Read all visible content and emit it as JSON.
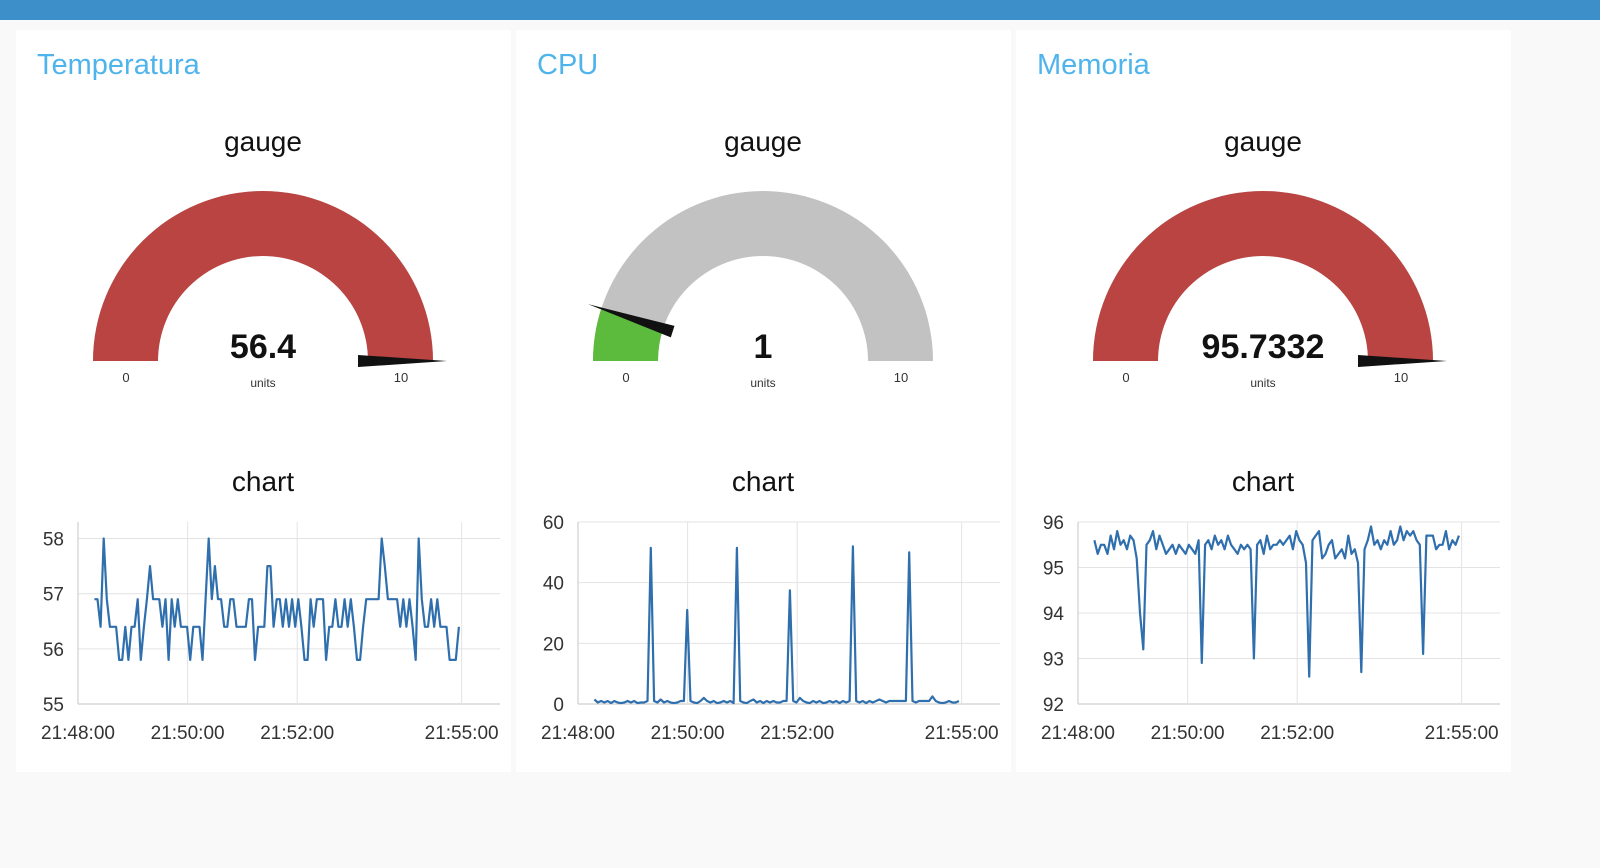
{
  "colors": {
    "header_bar": "#3d8fc9",
    "panel_title": "#4fb4ec",
    "gauge_alert": "#b94441",
    "gauge_track": "#c2c2c2",
    "gauge_ok": "#5cba3d",
    "line": "#2f6fad"
  },
  "panels": [
    {
      "title": "Temperatura",
      "gauge": {
        "label": "gauge",
        "value_text": "56.4",
        "value": 56.4,
        "units": "units",
        "min": 0,
        "max": 10,
        "min_label": "0",
        "max_label": "10",
        "fill_color": "#b94441"
      },
      "chart_label": "chart"
    },
    {
      "title": "CPU",
      "gauge": {
        "label": "gauge",
        "value_text": "1",
        "value": 1,
        "units": "units",
        "min": 0,
        "max": 10,
        "min_label": "0",
        "max_label": "10",
        "fill_color": "#5cba3d"
      },
      "chart_label": "chart"
    },
    {
      "title": "Memoria",
      "gauge": {
        "label": "gauge",
        "value_text": "95.7332",
        "value": 95.7332,
        "units": "units",
        "min": 0,
        "max": 10,
        "min_label": "0",
        "max_label": "10",
        "fill_color": "#b94441"
      },
      "chart_label": "chart"
    }
  ],
  "chart_data": [
    {
      "type": "line",
      "title": "chart",
      "x_ticks": [
        "21:48:00",
        "21:50:00",
        "21:52:00",
        "21:55:00"
      ],
      "x_tick_minutes": [
        0,
        2,
        4,
        7
      ],
      "xlim_minutes": [
        0,
        7.7
      ],
      "y_ticks": [
        "55",
        "56",
        "57",
        "58"
      ],
      "ylim": [
        55,
        58.3
      ],
      "grid": true,
      "series": [
        {
          "x_start_minute": 0.3,
          "x_end_minute": 6.95,
          "values": [
            56.9,
            56.9,
            56.4,
            58,
            56.9,
            56.4,
            56.4,
            56.4,
            55.8,
            55.8,
            56.4,
            55.8,
            56.4,
            56.4,
            56.9,
            55.8,
            56.4,
            56.9,
            57.5,
            56.9,
            56.9,
            56.9,
            56.4,
            56.9,
            55.8,
            56.9,
            56.4,
            56.9,
            56.4,
            56.4,
            56.4,
            55.8,
            56.4,
            56.4,
            56.4,
            55.8,
            56.9,
            58,
            56.9,
            57.5,
            56.9,
            56.9,
            56.4,
            56.4,
            56.9,
            56.9,
            56.4,
            56.4,
            56.4,
            56.4,
            56.9,
            56.9,
            55.8,
            56.4,
            56.4,
            56.4,
            57.5,
            57.5,
            56.4,
            56.9,
            56.9,
            56.4,
            56.9,
            56.4,
            56.9,
            56.4,
            56.9,
            56.4,
            55.8,
            55.8,
            56.9,
            56.4,
            56.9,
            56.9,
            56.9,
            55.8,
            56.4,
            56.4,
            56.9,
            56.4,
            56.4,
            56.9,
            56.4,
            56.9,
            56.4,
            55.8,
            55.8,
            56.4,
            56.9,
            56.9,
            56.9,
            56.9,
            56.9,
            58,
            57.5,
            56.9,
            56.9,
            56.9,
            56.9,
            56.4,
            56.9,
            56.4,
            56.9,
            56.4,
            55.8,
            58,
            56.9,
            56.4,
            56.4,
            56.9,
            56.4,
            56.9,
            56.4,
            56.4,
            56.4,
            55.8,
            55.8,
            55.8,
            56.4
          ]
        }
      ]
    },
    {
      "type": "line",
      "title": "chart",
      "x_ticks": [
        "21:48:00",
        "21:50:00",
        "21:52:00",
        "21:55:00"
      ],
      "x_tick_minutes": [
        0,
        2,
        4,
        7
      ],
      "xlim_minutes": [
        0,
        7.7
      ],
      "y_ticks": [
        "0",
        "20",
        "40",
        "60"
      ],
      "ylim": [
        0,
        60
      ],
      "grid": true,
      "series": [
        {
          "x_start_minute": 0.3,
          "x_end_minute": 6.95,
          "values": [
            1.5,
            0.5,
            1,
            0.5,
            1,
            0.3,
            1,
            0.5,
            0.3,
            0.5,
            1,
            0.5,
            1,
            0.3,
            0.5,
            0.5,
            1,
            51.5,
            1,
            0.5,
            1.5,
            0.5,
            1,
            0.5,
            0.3,
            0.5,
            1,
            1,
            31,
            1,
            0.5,
            0.3,
            1,
            2,
            1,
            0.5,
            1,
            0.3,
            0.5,
            1,
            0.5,
            1,
            0.3,
            51.5,
            1,
            0.5,
            0.3,
            1,
            1.5,
            0.5,
            1,
            0.3,
            1,
            0.5,
            1,
            0.5,
            0.5,
            1,
            1,
            37.5,
            1,
            0.5,
            2,
            1,
            0.5,
            0.3,
            1,
            0.5,
            1,
            0.3,
            0.5,
            1,
            0.5,
            1,
            0.3,
            1,
            0.5,
            1,
            52,
            1,
            0.5,
            1,
            0.3,
            1,
            0.5,
            1,
            1.5,
            1,
            0.5,
            1,
            1,
            1,
            1,
            1,
            1,
            50,
            1,
            0.5,
            1,
            1,
            1,
            1,
            2.5,
            1,
            0.5,
            0.3,
            0.5,
            1,
            0.5,
            0.5,
            1
          ]
        }
      ]
    },
    {
      "type": "line",
      "title": "chart",
      "x_ticks": [
        "21:48:00",
        "21:50:00",
        "21:52:00",
        "21:55:00"
      ],
      "x_tick_minutes": [
        0,
        2,
        4,
        7
      ],
      "xlim_minutes": [
        0,
        7.7
      ],
      "y_ticks": [
        "92",
        "93",
        "94",
        "95",
        "96"
      ],
      "ylim": [
        92,
        96
      ],
      "grid": true,
      "series": [
        {
          "x_start_minute": 0.3,
          "x_end_minute": 6.95,
          "values": [
            95.6,
            95.3,
            95.5,
            95.5,
            95.3,
            95.7,
            95.4,
            95.8,
            95.5,
            95.6,
            95.4,
            95.7,
            95.6,
            95.2,
            94,
            93.2,
            95.5,
            95.6,
            95.8,
            95.4,
            95.7,
            95.5,
            95.3,
            95.4,
            95.5,
            95.3,
            95.5,
            95.4,
            95.3,
            95.5,
            95.4,
            95.3,
            95.6,
            92.9,
            95.5,
            95.6,
            95.4,
            95.7,
            95.5,
            95.6,
            95.4,
            95.7,
            95.5,
            95.4,
            95.3,
            95.5,
            95.4,
            95.5,
            95.4,
            93,
            95.5,
            95.6,
            95.3,
            95.7,
            95.4,
            95.5,
            95.5,
            95.6,
            95.5,
            95.6,
            95.7,
            95.4,
            95.8,
            95.6,
            95.5,
            95.1,
            92.6,
            95.6,
            95.7,
            95.8,
            95.2,
            95.3,
            95.5,
            95.6,
            95.2,
            95.3,
            95.4,
            95.2,
            95.7,
            95.3,
            95.4,
            95.1,
            92.7,
            95.4,
            95.6,
            95.9,
            95.5,
            95.6,
            95.4,
            95.6,
            95.5,
            95.8,
            95.5,
            95.6,
            95.9,
            95.6,
            95.8,
            95.7,
            95.8,
            95.6,
            95.5,
            93.1,
            95.7,
            95.7,
            95.7,
            95.4,
            95.5,
            95.5,
            95.8,
            95.4,
            95.6,
            95.5,
            95.7
          ]
        }
      ]
    }
  ]
}
